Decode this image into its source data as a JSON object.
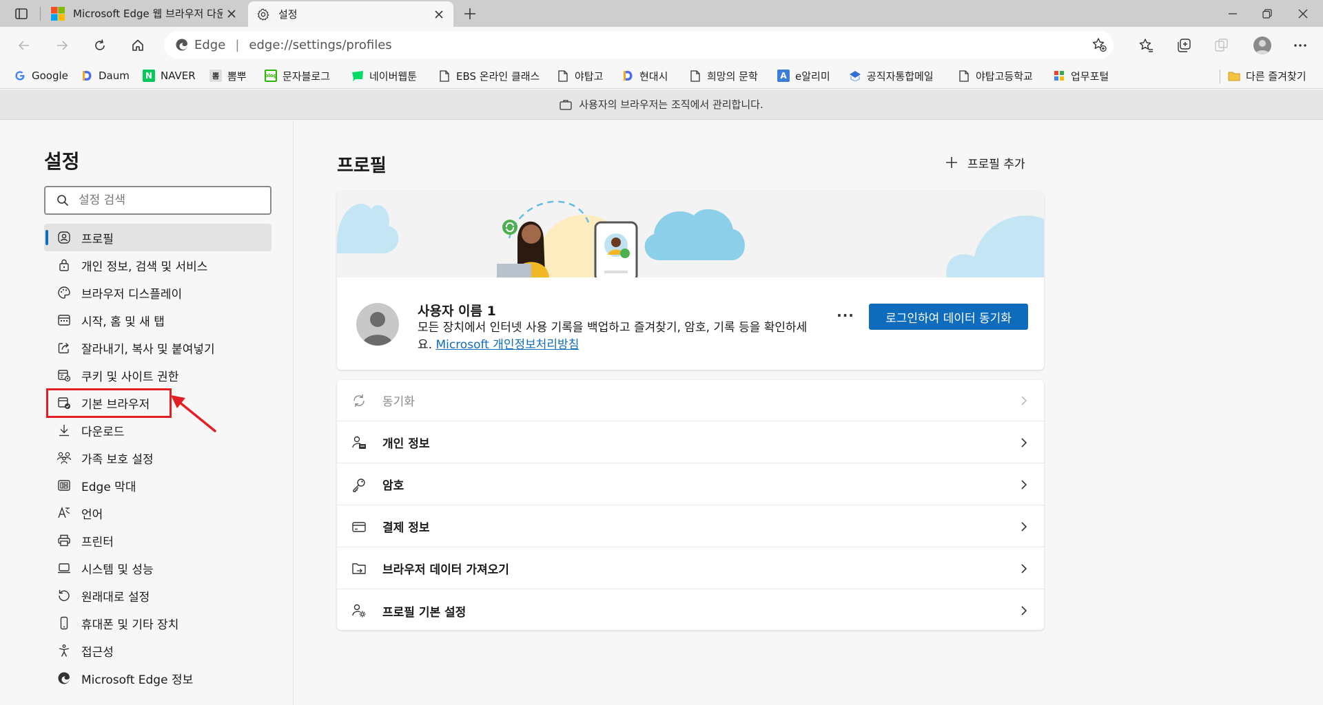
{
  "tabs": [
    {
      "title": "Microsoft Edge 웹 브라우저 다운로드",
      "active": false
    },
    {
      "title": "설정",
      "active": true
    }
  ],
  "address": {
    "site": "Edge",
    "url": "edge://settings/profiles"
  },
  "bookmarks": [
    {
      "label": "Google",
      "icon": "google-icon"
    },
    {
      "label": "Daum",
      "icon": "daum-icon"
    },
    {
      "label": "NAVER",
      "icon": "naver-icon"
    },
    {
      "label": "뽐뿌",
      "icon": "ppomppu-icon"
    },
    {
      "label": "문자블로그",
      "icon": "blog-icon"
    },
    {
      "label": "네이버웹툰",
      "icon": "webtoon-icon"
    },
    {
      "label": "EBS 온라인 클래스",
      "icon": "page-icon"
    },
    {
      "label": "야탑고",
      "icon": "page-icon"
    },
    {
      "label": "현대시",
      "icon": "daum-icon"
    },
    {
      "label": "희망의 문학",
      "icon": "page-icon"
    },
    {
      "label": "e알리미",
      "icon": "ealimi-icon"
    },
    {
      "label": "공직자통합메일",
      "icon": "mail-icon"
    },
    {
      "label": "야탑고등학교",
      "icon": "page-icon"
    },
    {
      "label": "업무포털",
      "icon": "portal-icon"
    }
  ],
  "other_favorites": "다른 즐겨찾기",
  "managed_notice": "사용자의 브라우저는 조직에서 관리합니다.",
  "sidebar": {
    "title": "설정",
    "search_placeholder": "설정 검색",
    "items": [
      {
        "label": "프로필",
        "icon": "profile-icon",
        "selected": true
      },
      {
        "label": "개인 정보, 검색 및 서비스",
        "icon": "lock-icon"
      },
      {
        "label": "브라우저 디스플레이",
        "icon": "palette-icon"
      },
      {
        "label": "시작, 홈 및 새 탭",
        "icon": "start-icon"
      },
      {
        "label": "잘라내기, 복사 및 붙여넣기",
        "icon": "share-icon"
      },
      {
        "label": "쿠키 및 사이트 권한",
        "icon": "cookie-icon"
      },
      {
        "label": "기본 브라우저",
        "icon": "default-browser-icon"
      },
      {
        "label": "다운로드",
        "icon": "download-icon"
      },
      {
        "label": "가족 보호 설정",
        "icon": "family-icon"
      },
      {
        "label": "Edge 막대",
        "icon": "edge-bar-icon"
      },
      {
        "label": "언어",
        "icon": "language-icon"
      },
      {
        "label": "프린터",
        "icon": "printer-icon"
      },
      {
        "label": "시스템 및 성능",
        "icon": "laptop-icon"
      },
      {
        "label": "원래대로 설정",
        "icon": "reset-icon"
      },
      {
        "label": "휴대폰 및 기타 장치",
        "icon": "phone-icon"
      },
      {
        "label": "접근성",
        "icon": "accessibility-icon"
      },
      {
        "label": "Microsoft Edge 정보",
        "icon": "edge-icon"
      }
    ]
  },
  "main": {
    "title": "프로필",
    "add_profile": "프로필 추가",
    "profile": {
      "name": "사용자 이름 1",
      "desc": "모든 장치에서 인터넷 사용 기록을 백업하고 즐겨찾기, 암호, 기록 등을 확인하세요.",
      "privacy_link": "Microsoft 개인정보처리방침",
      "more": "···",
      "signin_button": "로그인하여 데이터 동기화"
    },
    "rows": [
      {
        "label": "동기화",
        "icon": "sync-icon",
        "disabled": true
      },
      {
        "label": "개인 정보",
        "icon": "personal-info-icon"
      },
      {
        "label": "암호",
        "icon": "key-icon"
      },
      {
        "label": "결제 정보",
        "icon": "card-icon"
      },
      {
        "label": "브라우저 데이터 가져오기",
        "icon": "import-icon"
      },
      {
        "label": "프로필 기본 설정",
        "icon": "profile-settings-icon"
      }
    ]
  },
  "colors": {
    "accent": "#0f6cbd",
    "highlight": "#e21d24"
  }
}
